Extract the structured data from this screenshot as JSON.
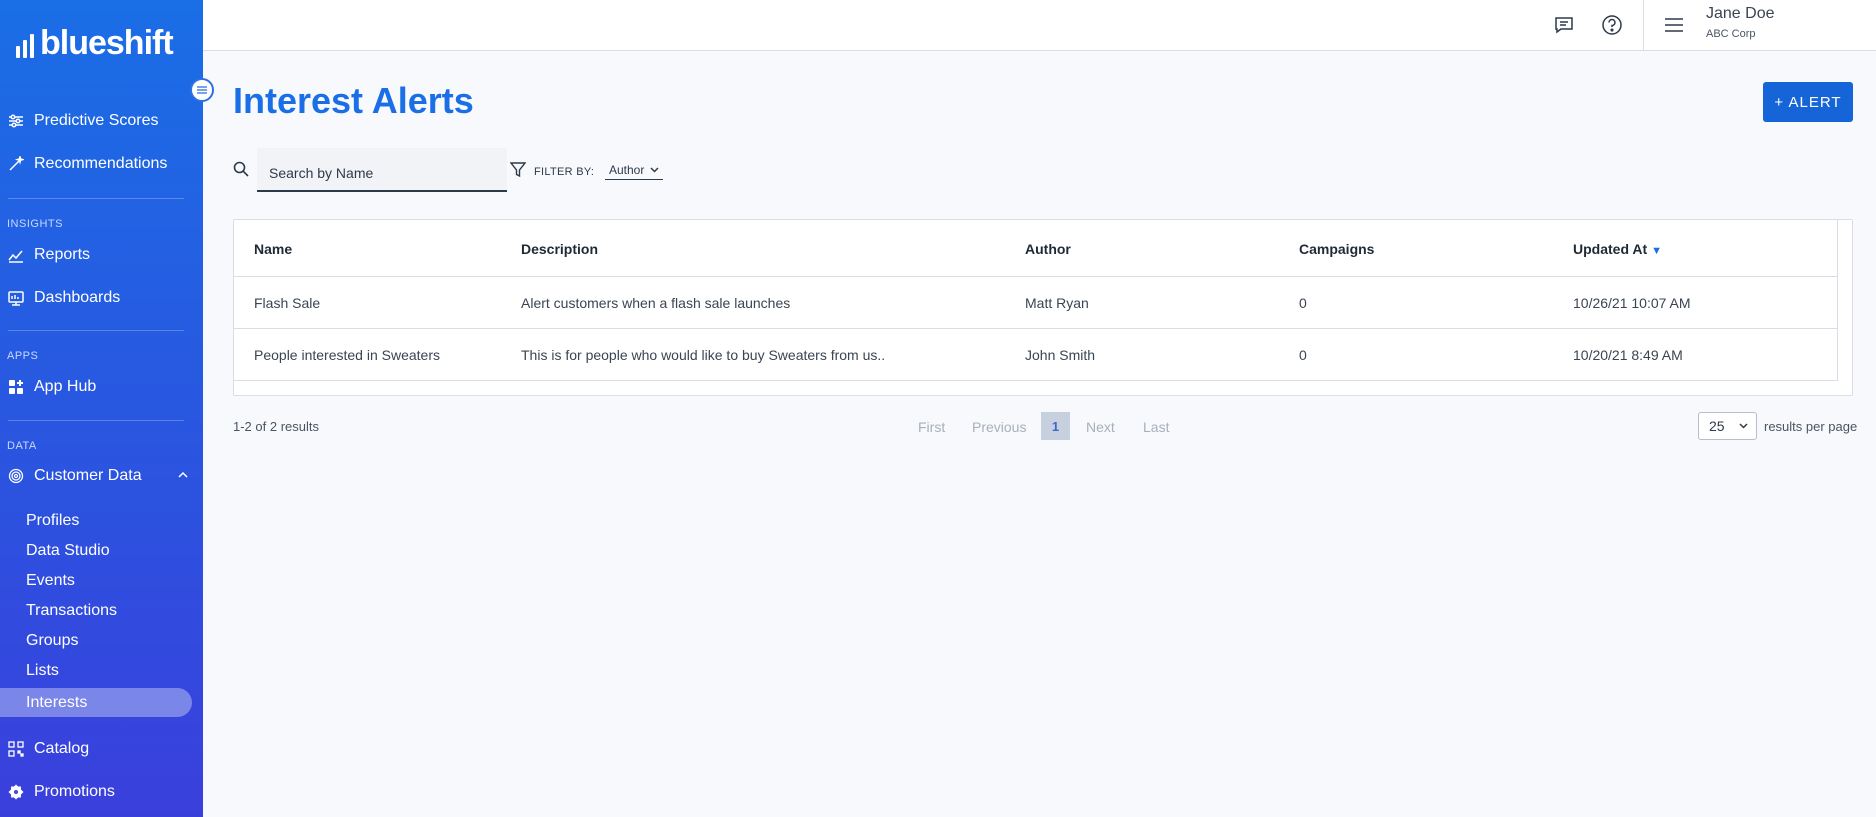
{
  "brand": {
    "logo_text": "blueshift"
  },
  "sidebar": {
    "items_top": [
      {
        "label": "Predictive Scores",
        "icon": "sliders-icon"
      },
      {
        "label": "Recommendations",
        "icon": "magic-wand-icon"
      }
    ],
    "insights_label": "INSIGHTS",
    "insights": [
      {
        "label": "Reports",
        "icon": "line-chart-icon"
      },
      {
        "label": "Dashboards",
        "icon": "dashboard-icon"
      }
    ],
    "apps_label": "APPS",
    "apps": [
      {
        "label": "App Hub",
        "icon": "grid-plus-icon"
      }
    ],
    "data_label": "DATA",
    "customer_data": {
      "label": "Customer Data",
      "icon": "fingerprint-icon",
      "expanded": true
    },
    "customer_data_children": [
      "Profiles",
      "Data Studio",
      "Events",
      "Transactions",
      "Groups",
      "Lists",
      "Interests"
    ],
    "active_child": "Interests",
    "items_bottom": [
      {
        "label": "Catalog",
        "icon": "qr-code-icon"
      },
      {
        "label": "Promotions",
        "icon": "badge-icon"
      }
    ]
  },
  "topbar": {
    "user_name": "Jane Doe",
    "user_org": "ABC Corp"
  },
  "page": {
    "title": "Interest Alerts",
    "add_button": "+ ALERT",
    "search_placeholder": "Search by Name",
    "filter_label": "FILTER BY:",
    "filter_value": "Author"
  },
  "table": {
    "columns": [
      "Name",
      "Description",
      "Author",
      "Campaigns",
      "Updated At"
    ],
    "sort_column": "Updated At",
    "rows": [
      [
        "Flash Sale",
        "Alert customers when a flash sale launches",
        "Matt Ryan",
        "0",
        "10/26/21 10:07 AM"
      ],
      [
        "People interested in Sweaters",
        "This is for people who would like to buy Sweaters from us..",
        "John Smith",
        "0",
        "10/20/21 8:49 AM"
      ]
    ]
  },
  "pagination": {
    "summary": "1-2 of 2 results",
    "first": "First",
    "previous": "Previous",
    "current": "1",
    "next": "Next",
    "last": "Last",
    "per_page_value": "25",
    "per_page_label": "results per page"
  },
  "colors": {
    "accent": "#1a6ee6",
    "button": "#1565d8"
  }
}
